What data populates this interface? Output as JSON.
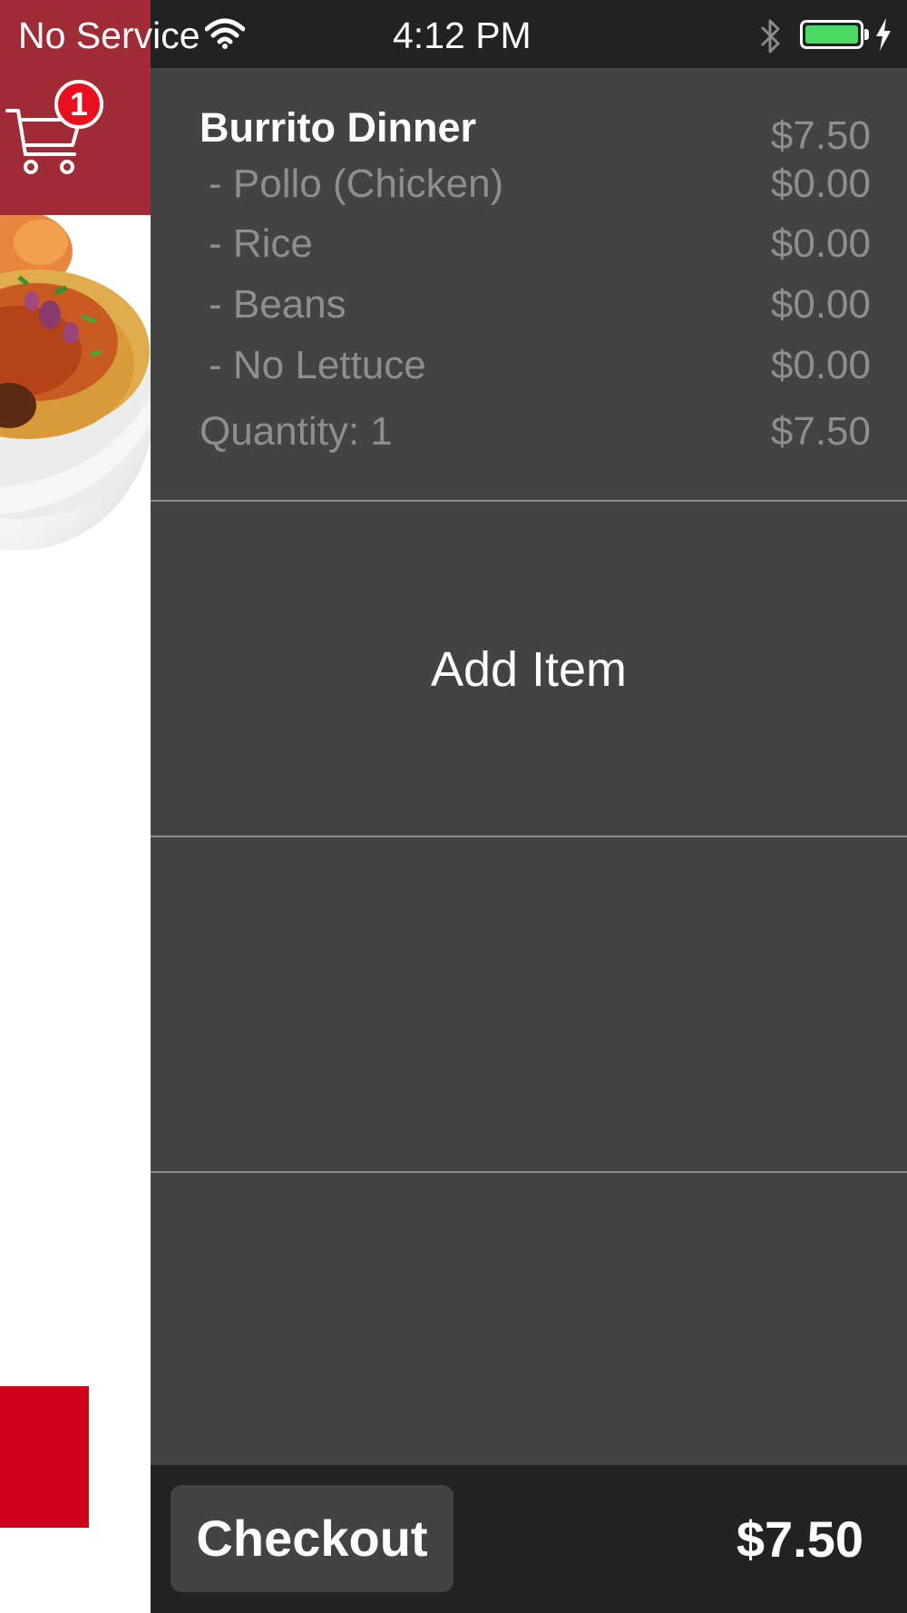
{
  "status_bar": {
    "carrier": "No Service",
    "time": "4:12 PM",
    "icons": [
      "wifi-icon",
      "bluetooth-icon",
      "battery-icon",
      "charging-bolt-icon"
    ],
    "battery_color": "#4cd964"
  },
  "left_menu": {
    "cart_badge_count": "1",
    "icons": [
      "shopping-cart-icon"
    ],
    "header_color": "#9e2b35",
    "accent_color": "#d0001a"
  },
  "cart": {
    "item": {
      "name": "Burrito Dinner",
      "price": "$7.50",
      "modifiers": [
        {
          "label": "- Pollo (Chicken)",
          "price": "$0.00"
        },
        {
          "label": "- Rice",
          "price": "$0.00"
        },
        {
          "label": "- Beans",
          "price": "$0.00"
        },
        {
          "label": "- No Lettuce",
          "price": "$0.00"
        }
      ],
      "quantity_label": "Quantity: 1",
      "quantity_total": "$7.50"
    },
    "add_item_label": "Add Item"
  },
  "footer": {
    "checkout_label": "Checkout",
    "total": "$7.50"
  }
}
